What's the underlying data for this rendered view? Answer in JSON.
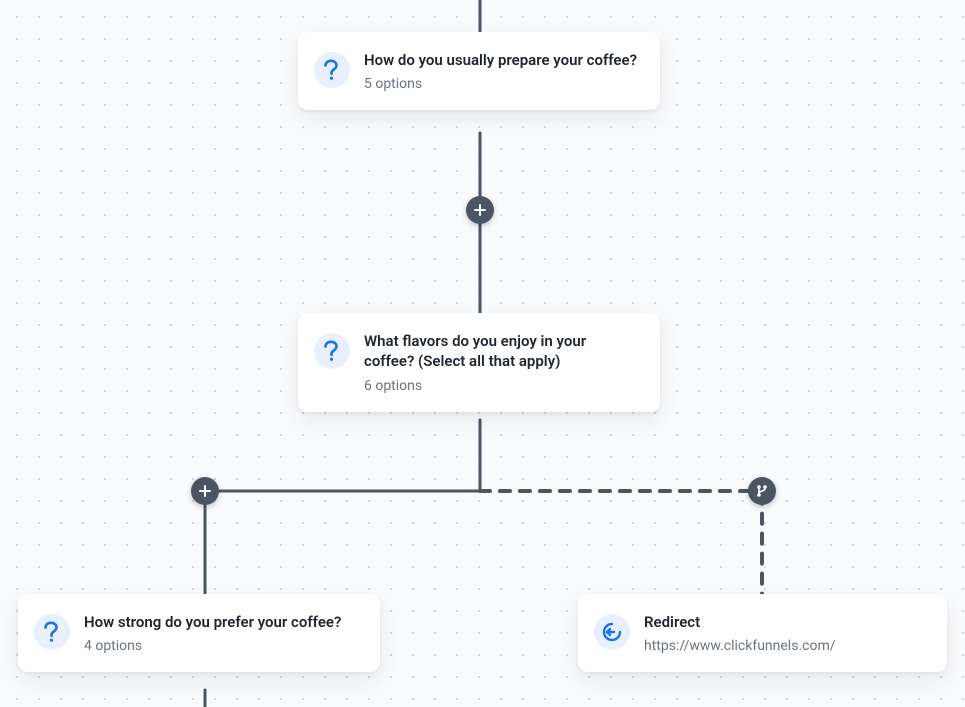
{
  "colors": {
    "connector": "#4b5563",
    "iconBg": "#e8f0fe",
    "iconFg": "#1a73e8",
    "nodeBg": "#ffffff",
    "textPrimary": "#1f2430",
    "textSecondary": "#6b7280",
    "dot": "#c6c9cf",
    "plusBg": "#4b5563"
  },
  "nodes": {
    "q1": {
      "type": "question",
      "title": "How do you usually prepare your coffee?",
      "sub": "5 options"
    },
    "q2": {
      "type": "question",
      "title": "What flavors do you enjoy in your coffee? (Select all that apply)",
      "sub": "6 options"
    },
    "q3": {
      "type": "question",
      "title": "How strong do you prefer your coffee?",
      "sub": "4 options"
    },
    "redirect": {
      "type": "redirect",
      "title": "Redirect",
      "sub": "https://www.clickfunnels.com/"
    }
  },
  "icons": {
    "question": "question-icon",
    "redirect": "redirect-arrow-icon",
    "plus": "plus-icon",
    "branch": "branch-icon"
  }
}
